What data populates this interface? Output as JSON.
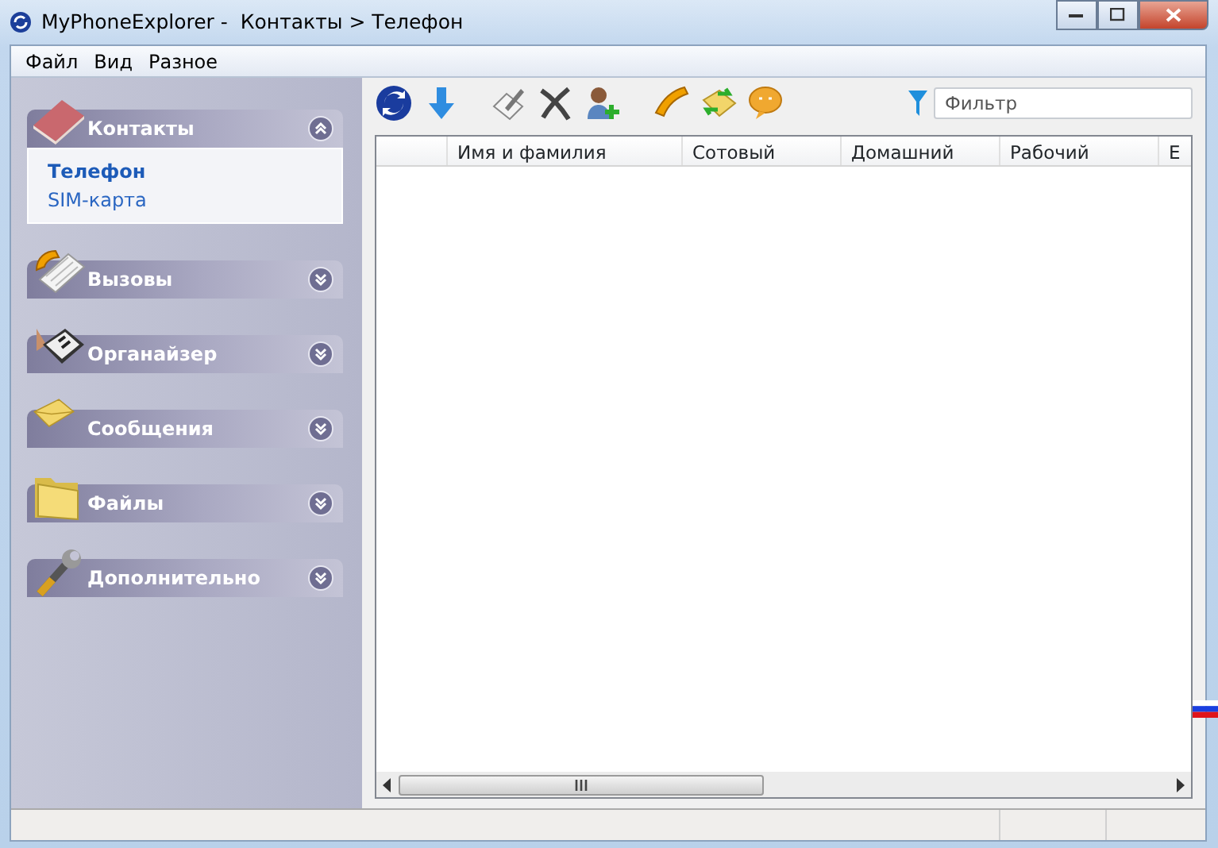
{
  "window": {
    "title": "MyPhoneExplorer -  Контакты > Телефон"
  },
  "menu": [
    "Файл",
    "Вид",
    "Разное"
  ],
  "sidebar": {
    "sections": [
      {
        "kind": "contacts",
        "label": "Контакты",
        "expanded": true,
        "items": [
          {
            "label": "Телефон",
            "selected": true
          },
          {
            "label": "SIM-карта",
            "selected": false
          }
        ]
      },
      {
        "kind": "calls",
        "label": "Вызовы",
        "expanded": false
      },
      {
        "kind": "organizer",
        "label": "Органайзер",
        "expanded": false
      },
      {
        "kind": "messages",
        "label": "Сообщения",
        "expanded": false
      },
      {
        "kind": "files",
        "label": "Файлы",
        "expanded": false
      },
      {
        "kind": "tools",
        "label": "Дополнительно",
        "expanded": false
      }
    ]
  },
  "filter": {
    "placeholder": "Фильтр"
  },
  "table": {
    "columns": [
      "Имя и фамилия",
      "Сотовый",
      "Домашний",
      "Рабочий",
      "E"
    ]
  }
}
